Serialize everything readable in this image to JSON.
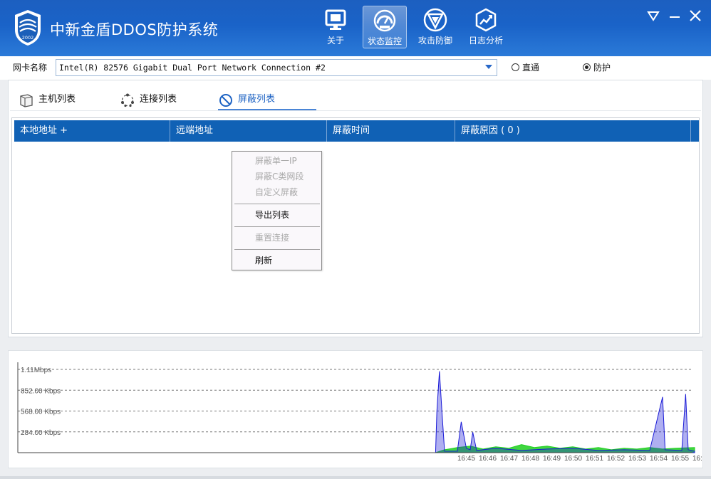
{
  "app": {
    "title": "中新金盾DDOS防护系统",
    "logo_text": "2002"
  },
  "nav": {
    "items": [
      {
        "label": "关于",
        "icon": "monitor-icon"
      },
      {
        "label": "状态监控",
        "icon": "speedometer-icon",
        "active": true
      },
      {
        "label": "攻击防御",
        "icon": "shield-icon"
      },
      {
        "label": "日志分析",
        "icon": "chart-icon"
      }
    ]
  },
  "window_controls": [
    "menu-down-icon",
    "minimize-icon",
    "close-icon"
  ],
  "nic": {
    "label": "网卡名称",
    "value": "Intel(R) 82576 Gigabit Dual Port Network Connection #2",
    "modes": [
      {
        "label": "直通",
        "selected": false
      },
      {
        "label": "防护",
        "selected": true
      }
    ]
  },
  "tabs": [
    {
      "label": "主机列表",
      "icon": "host-list-icon",
      "active": false
    },
    {
      "label": "连接列表",
      "icon": "connection-list-icon",
      "active": false
    },
    {
      "label": "屏蔽列表",
      "icon": "block-list-icon",
      "active": true
    }
  ],
  "table": {
    "columns": [
      "本地地址 +",
      "远端地址",
      "屏蔽时间",
      "屏蔽原因 ( 0 )"
    ],
    "rows": []
  },
  "context_menu": {
    "items": [
      {
        "label": "屏蔽单一IP",
        "enabled": false
      },
      {
        "label": "屏蔽C类网段",
        "enabled": false
      },
      {
        "label": "自定义屏蔽",
        "enabled": false
      },
      {
        "separator": true
      },
      {
        "label": "导出列表",
        "enabled": true
      },
      {
        "separator": true
      },
      {
        "label": "重置连接",
        "enabled": false
      },
      {
        "separator": true
      },
      {
        "label": "刷新",
        "enabled": true
      }
    ]
  },
  "colors": {
    "titlebar": "#1a63c8",
    "table_header": "#1061b5",
    "series_in": "#1a1ad6",
    "series_out": "#1fcf1f"
  },
  "chart_data": {
    "type": "area",
    "ylabel_ticks": [
      "1.11Mbps",
      "852.00 Kbps",
      "568.00 Kbps",
      "284.00 Kbps"
    ],
    "ytick_values_kbps": [
      1136,
      852,
      568,
      284
    ],
    "ylim_kbps": [
      0,
      1136
    ],
    "x_ticks": [
      "16:45",
      "16:46",
      "16:47",
      "16:48",
      "16:49",
      "16:50",
      "16:51",
      "16:52",
      "16:53",
      "16:54",
      "16:55",
      "16:"
    ],
    "grid": true,
    "series": [
      {
        "color": "#1a1ad6",
        "points": [
          [
            16.733,
            0
          ],
          [
            16.734,
            560
          ],
          [
            16.736,
            1110
          ],
          [
            16.738,
            550
          ],
          [
            16.74,
            20
          ],
          [
            16.75,
            20
          ],
          [
            16.753,
            420
          ],
          [
            16.755,
            240
          ],
          [
            16.757,
            60
          ],
          [
            16.76,
            40
          ],
          [
            16.762,
            280
          ],
          [
            16.765,
            30
          ],
          [
            16.78,
            60
          ],
          [
            16.8,
            30
          ],
          [
            16.82,
            50
          ],
          [
            16.84,
            60
          ],
          [
            16.86,
            30
          ],
          [
            16.88,
            40
          ],
          [
            16.9,
            30
          ],
          [
            16.91,
            760
          ],
          [
            16.912,
            40
          ],
          [
            16.925,
            30
          ],
          [
            16.928,
            800
          ],
          [
            16.93,
            40
          ],
          [
            16.935,
            20
          ]
        ]
      },
      {
        "color": "#1fcf1f",
        "points": [
          [
            16.733,
            0
          ],
          [
            16.74,
            40
          ],
          [
            16.75,
            70
          ],
          [
            16.76,
            90
          ],
          [
            16.77,
            50
          ],
          [
            16.78,
            80
          ],
          [
            16.79,
            60
          ],
          [
            16.8,
            110
          ],
          [
            16.81,
            70
          ],
          [
            16.82,
            90
          ],
          [
            16.83,
            60
          ],
          [
            16.84,
            80
          ],
          [
            16.85,
            50
          ],
          [
            16.86,
            70
          ],
          [
            16.87,
            40
          ],
          [
            16.88,
            60
          ],
          [
            16.89,
            50
          ],
          [
            16.9,
            70
          ],
          [
            16.91,
            50
          ],
          [
            16.92,
            60
          ],
          [
            16.935,
            70
          ]
        ]
      }
    ]
  }
}
